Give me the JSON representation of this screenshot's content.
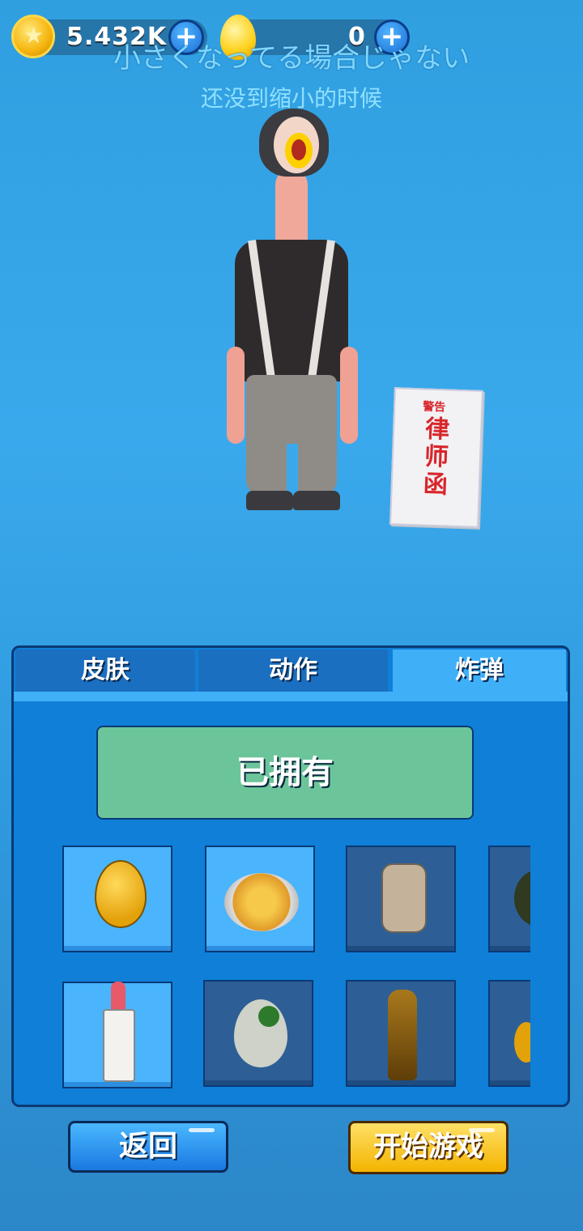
{
  "currency": {
    "coins": "5.432K",
    "eggs": "0"
  },
  "title_jp": "小さくなってる場合じゃない",
  "subtitle_cn": "还没到缩小的时候",
  "item_preview": {
    "letter_header": "警告",
    "letter_title": "律师函"
  },
  "tabs": [
    {
      "label": "皮肤",
      "active": false
    },
    {
      "label": "动作",
      "active": false
    },
    {
      "label": "炸弹",
      "active": true
    }
  ],
  "owned_label": "已拥有",
  "items": [
    {
      "icon": "golden-egg-icon",
      "locked": false
    },
    {
      "icon": "omelette-bowl-icon",
      "locked": false
    },
    {
      "icon": "stone-plaque-icon",
      "locked": true
    },
    {
      "icon": "durian-icon",
      "locked": true
    },
    {
      "icon": "lipstick-icon",
      "locked": false
    },
    {
      "icon": "dino-egg-icon",
      "locked": true
    },
    {
      "icon": "trophy-icon",
      "locked": true
    },
    {
      "icon": "gourd-icon",
      "locked": true
    }
  ],
  "buttons": {
    "back": "返回",
    "start": "开始游戏"
  },
  "colors": {
    "background": "#3aa9ec",
    "panel": "#0f7fd8",
    "owned": "#6cc59a",
    "start": "#f4b400"
  }
}
